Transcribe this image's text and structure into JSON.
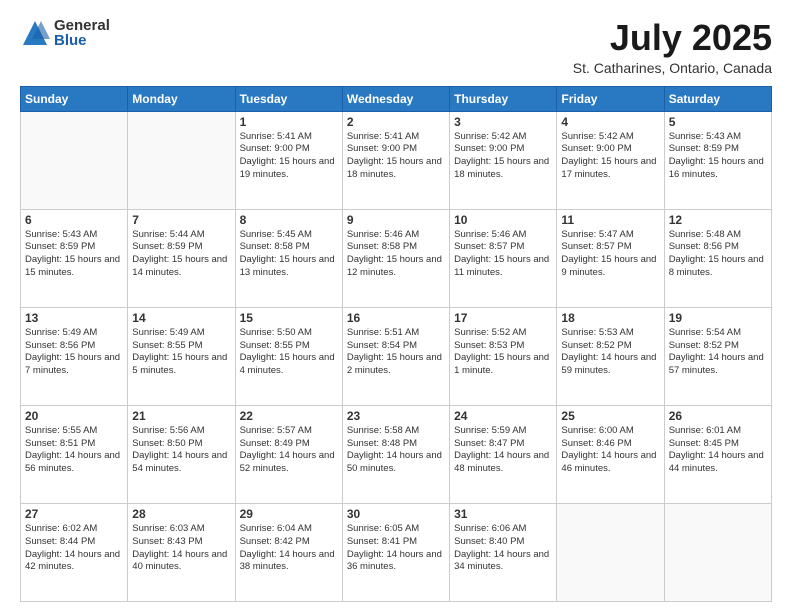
{
  "logo": {
    "general": "General",
    "blue": "Blue"
  },
  "header": {
    "month": "July 2025",
    "location": "St. Catharines, Ontario, Canada"
  },
  "weekdays": [
    "Sunday",
    "Monday",
    "Tuesday",
    "Wednesday",
    "Thursday",
    "Friday",
    "Saturday"
  ],
  "weeks": [
    [
      {
        "day": "",
        "sunrise": "",
        "sunset": "",
        "daylight": ""
      },
      {
        "day": "",
        "sunrise": "",
        "sunset": "",
        "daylight": ""
      },
      {
        "day": "1",
        "sunrise": "Sunrise: 5:41 AM",
        "sunset": "Sunset: 9:00 PM",
        "daylight": "Daylight: 15 hours and 19 minutes."
      },
      {
        "day": "2",
        "sunrise": "Sunrise: 5:41 AM",
        "sunset": "Sunset: 9:00 PM",
        "daylight": "Daylight: 15 hours and 18 minutes."
      },
      {
        "day": "3",
        "sunrise": "Sunrise: 5:42 AM",
        "sunset": "Sunset: 9:00 PM",
        "daylight": "Daylight: 15 hours and 18 minutes."
      },
      {
        "day": "4",
        "sunrise": "Sunrise: 5:42 AM",
        "sunset": "Sunset: 9:00 PM",
        "daylight": "Daylight: 15 hours and 17 minutes."
      },
      {
        "day": "5",
        "sunrise": "Sunrise: 5:43 AM",
        "sunset": "Sunset: 8:59 PM",
        "daylight": "Daylight: 15 hours and 16 minutes."
      }
    ],
    [
      {
        "day": "6",
        "sunrise": "Sunrise: 5:43 AM",
        "sunset": "Sunset: 8:59 PM",
        "daylight": "Daylight: 15 hours and 15 minutes."
      },
      {
        "day": "7",
        "sunrise": "Sunrise: 5:44 AM",
        "sunset": "Sunset: 8:59 PM",
        "daylight": "Daylight: 15 hours and 14 minutes."
      },
      {
        "day": "8",
        "sunrise": "Sunrise: 5:45 AM",
        "sunset": "Sunset: 8:58 PM",
        "daylight": "Daylight: 15 hours and 13 minutes."
      },
      {
        "day": "9",
        "sunrise": "Sunrise: 5:46 AM",
        "sunset": "Sunset: 8:58 PM",
        "daylight": "Daylight: 15 hours and 12 minutes."
      },
      {
        "day": "10",
        "sunrise": "Sunrise: 5:46 AM",
        "sunset": "Sunset: 8:57 PM",
        "daylight": "Daylight: 15 hours and 11 minutes."
      },
      {
        "day": "11",
        "sunrise": "Sunrise: 5:47 AM",
        "sunset": "Sunset: 8:57 PM",
        "daylight": "Daylight: 15 hours and 9 minutes."
      },
      {
        "day": "12",
        "sunrise": "Sunrise: 5:48 AM",
        "sunset": "Sunset: 8:56 PM",
        "daylight": "Daylight: 15 hours and 8 minutes."
      }
    ],
    [
      {
        "day": "13",
        "sunrise": "Sunrise: 5:49 AM",
        "sunset": "Sunset: 8:56 PM",
        "daylight": "Daylight: 15 hours and 7 minutes."
      },
      {
        "day": "14",
        "sunrise": "Sunrise: 5:49 AM",
        "sunset": "Sunset: 8:55 PM",
        "daylight": "Daylight: 15 hours and 5 minutes."
      },
      {
        "day": "15",
        "sunrise": "Sunrise: 5:50 AM",
        "sunset": "Sunset: 8:55 PM",
        "daylight": "Daylight: 15 hours and 4 minutes."
      },
      {
        "day": "16",
        "sunrise": "Sunrise: 5:51 AM",
        "sunset": "Sunset: 8:54 PM",
        "daylight": "Daylight: 15 hours and 2 minutes."
      },
      {
        "day": "17",
        "sunrise": "Sunrise: 5:52 AM",
        "sunset": "Sunset: 8:53 PM",
        "daylight": "Daylight: 15 hours and 1 minute."
      },
      {
        "day": "18",
        "sunrise": "Sunrise: 5:53 AM",
        "sunset": "Sunset: 8:52 PM",
        "daylight": "Daylight: 14 hours and 59 minutes."
      },
      {
        "day": "19",
        "sunrise": "Sunrise: 5:54 AM",
        "sunset": "Sunset: 8:52 PM",
        "daylight": "Daylight: 14 hours and 57 minutes."
      }
    ],
    [
      {
        "day": "20",
        "sunrise": "Sunrise: 5:55 AM",
        "sunset": "Sunset: 8:51 PM",
        "daylight": "Daylight: 14 hours and 56 minutes."
      },
      {
        "day": "21",
        "sunrise": "Sunrise: 5:56 AM",
        "sunset": "Sunset: 8:50 PM",
        "daylight": "Daylight: 14 hours and 54 minutes."
      },
      {
        "day": "22",
        "sunrise": "Sunrise: 5:57 AM",
        "sunset": "Sunset: 8:49 PM",
        "daylight": "Daylight: 14 hours and 52 minutes."
      },
      {
        "day": "23",
        "sunrise": "Sunrise: 5:58 AM",
        "sunset": "Sunset: 8:48 PM",
        "daylight": "Daylight: 14 hours and 50 minutes."
      },
      {
        "day": "24",
        "sunrise": "Sunrise: 5:59 AM",
        "sunset": "Sunset: 8:47 PM",
        "daylight": "Daylight: 14 hours and 48 minutes."
      },
      {
        "day": "25",
        "sunrise": "Sunrise: 6:00 AM",
        "sunset": "Sunset: 8:46 PM",
        "daylight": "Daylight: 14 hours and 46 minutes."
      },
      {
        "day": "26",
        "sunrise": "Sunrise: 6:01 AM",
        "sunset": "Sunset: 8:45 PM",
        "daylight": "Daylight: 14 hours and 44 minutes."
      }
    ],
    [
      {
        "day": "27",
        "sunrise": "Sunrise: 6:02 AM",
        "sunset": "Sunset: 8:44 PM",
        "daylight": "Daylight: 14 hours and 42 minutes."
      },
      {
        "day": "28",
        "sunrise": "Sunrise: 6:03 AM",
        "sunset": "Sunset: 8:43 PM",
        "daylight": "Daylight: 14 hours and 40 minutes."
      },
      {
        "day": "29",
        "sunrise": "Sunrise: 6:04 AM",
        "sunset": "Sunset: 8:42 PM",
        "daylight": "Daylight: 14 hours and 38 minutes."
      },
      {
        "day": "30",
        "sunrise": "Sunrise: 6:05 AM",
        "sunset": "Sunset: 8:41 PM",
        "daylight": "Daylight: 14 hours and 36 minutes."
      },
      {
        "day": "31",
        "sunrise": "Sunrise: 6:06 AM",
        "sunset": "Sunset: 8:40 PM",
        "daylight": "Daylight: 14 hours and 34 minutes."
      },
      {
        "day": "",
        "sunrise": "",
        "sunset": "",
        "daylight": ""
      },
      {
        "day": "",
        "sunrise": "",
        "sunset": "",
        "daylight": ""
      }
    ]
  ]
}
